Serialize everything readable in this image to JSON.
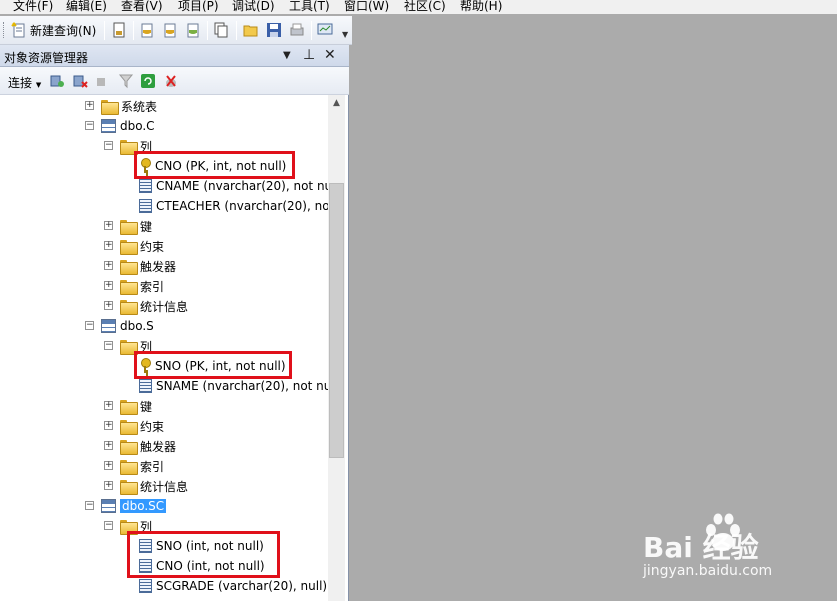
{
  "menubar": {
    "items": [
      "文件(F)",
      "编辑(E)",
      "查看(V)",
      "项目(P)",
      "调试(D)",
      "工具(T)",
      "窗口(W)",
      "社区(C)",
      "帮助(H)"
    ]
  },
  "toolbar": {
    "new_query_label": "新建查询(N)"
  },
  "object_explorer": {
    "title": "对象资源管理器",
    "connect_label": "连接",
    "tree": [
      {
        "label": "系统表"
      },
      {
        "label": "dbo.C"
      },
      {
        "label": "列"
      },
      {
        "label": "CNO (PK, int, not null)"
      },
      {
        "label": "CNAME (nvarchar(20), not nu"
      },
      {
        "label": "CTEACHER (nvarchar(20), not"
      },
      {
        "label": "键"
      },
      {
        "label": "约束"
      },
      {
        "label": "触发器"
      },
      {
        "label": "索引"
      },
      {
        "label": "统计信息"
      },
      {
        "label": "dbo.S"
      },
      {
        "label": "列"
      },
      {
        "label": "SNO (PK, int, not null)"
      },
      {
        "label": "SNAME (nvarchar(20), not nu"
      },
      {
        "label": "键"
      },
      {
        "label": "约束"
      },
      {
        "label": "触发器"
      },
      {
        "label": "索引"
      },
      {
        "label": "统计信息"
      },
      {
        "label": "dbo.SC"
      },
      {
        "label": "列"
      },
      {
        "label": "SNO (int, not null)"
      },
      {
        "label": "CNO (int, not null)"
      },
      {
        "label": "SCGRADE (varchar(20), null)"
      }
    ]
  },
  "watermark": {
    "logo": "Bai  经验",
    "url": "jingyan.baidu.com"
  },
  "colors": {
    "highlight": "#e0101a",
    "selection": "#3399ff",
    "workspace": "#ababab"
  }
}
